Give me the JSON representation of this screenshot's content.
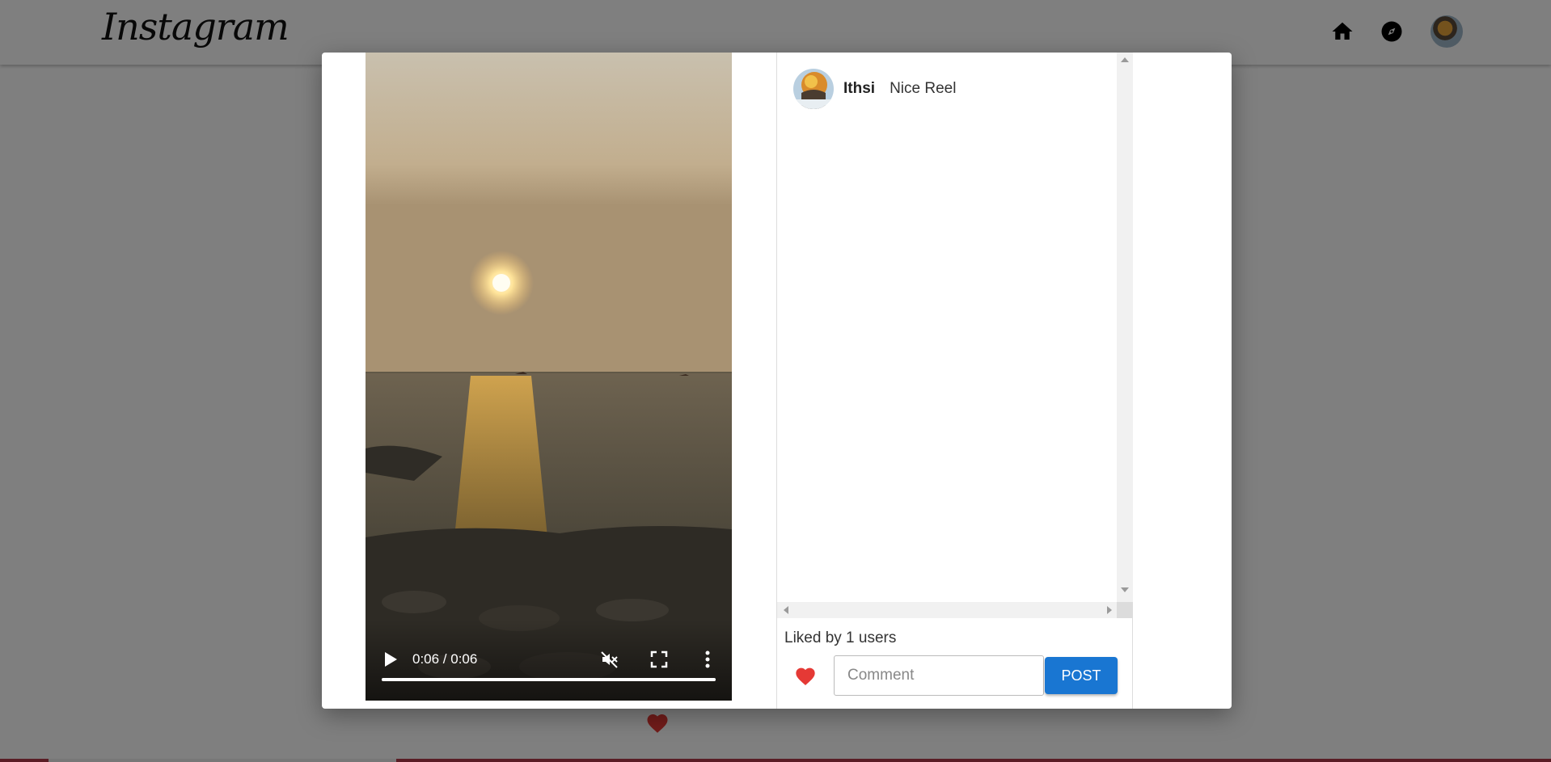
{
  "app": {
    "logo_text": "Instagram",
    "nav": {
      "home_icon": "home-icon",
      "explore_icon": "explore-compass-icon",
      "avatar_icon": "profile-avatar"
    }
  },
  "modal": {
    "video": {
      "time_display": "0:06 / 0:06",
      "progress": 1.0,
      "controls": [
        "play-icon",
        "mute-icon",
        "fullscreen-icon",
        "more-options-icon"
      ]
    },
    "comments": [
      {
        "username": "Ithsi",
        "text": "Nice Reel"
      }
    ],
    "liked_by": "Liked by 1 users",
    "comment_input": {
      "placeholder": "Comment",
      "value": ""
    },
    "post_button": "POST"
  },
  "colors": {
    "like_red": "#e53935",
    "post_blue": "#1976d2",
    "backdrop": "rgba(0,0,0,0.5)"
  }
}
